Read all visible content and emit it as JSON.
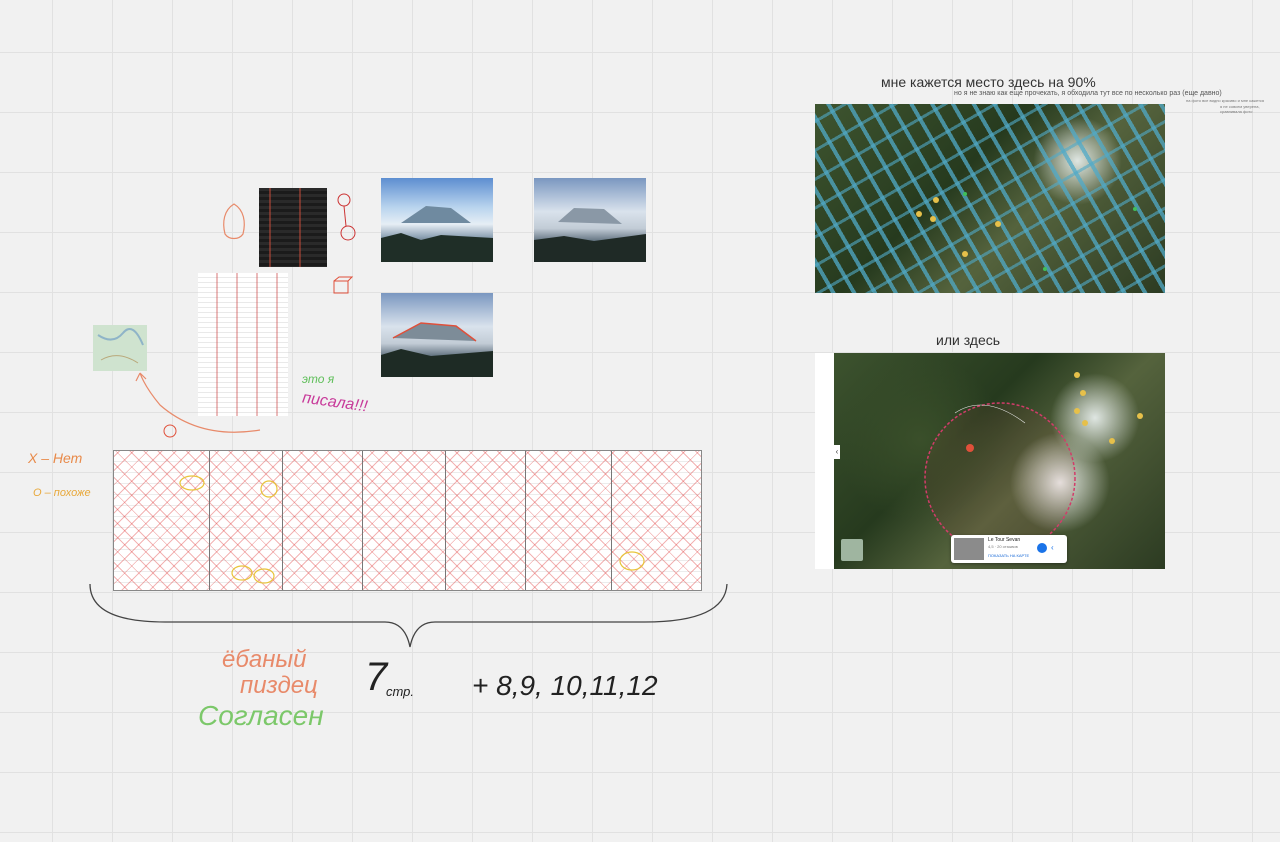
{
  "board": {
    "caption_main": "мне кажется место здесь на 90%",
    "caption_sub": "но я не знаю как еще прочекать, я обходила тут все по несколько раз (еще давно)",
    "caption_tiny_1": "на фото все видно красиво и мне кажется",
    "caption_tiny_2": "я не совсем уверена, сравнивала фото",
    "caption_alt": "или здесь"
  },
  "handwriting": {
    "x_label": "X – Нет",
    "o_label": "O – похоже",
    "note_pink_1": "это я",
    "note_pink_2": "писала!!!",
    "red_1": "ёбаный",
    "red_2": "пиздец",
    "green": "Согласен",
    "pages_main": "7",
    "pages_unit": "стр.",
    "pages_more": "+ 8,9, 10,11,12"
  },
  "map_popup": {
    "title": "Le Tour Sevan",
    "line1": "4,5 · 20 отзывов",
    "link": "ПОКАЗАТЬ НА КАРТЕ"
  },
  "icons": {
    "route": "route-icon",
    "search": "search-icon",
    "chevron": "chevron-left-icon"
  },
  "colors": {
    "accent_red": "#e0503a",
    "green_note": "#7cc86a",
    "pink_note": "#c83a9a",
    "orange_note": "#e88a4a"
  }
}
